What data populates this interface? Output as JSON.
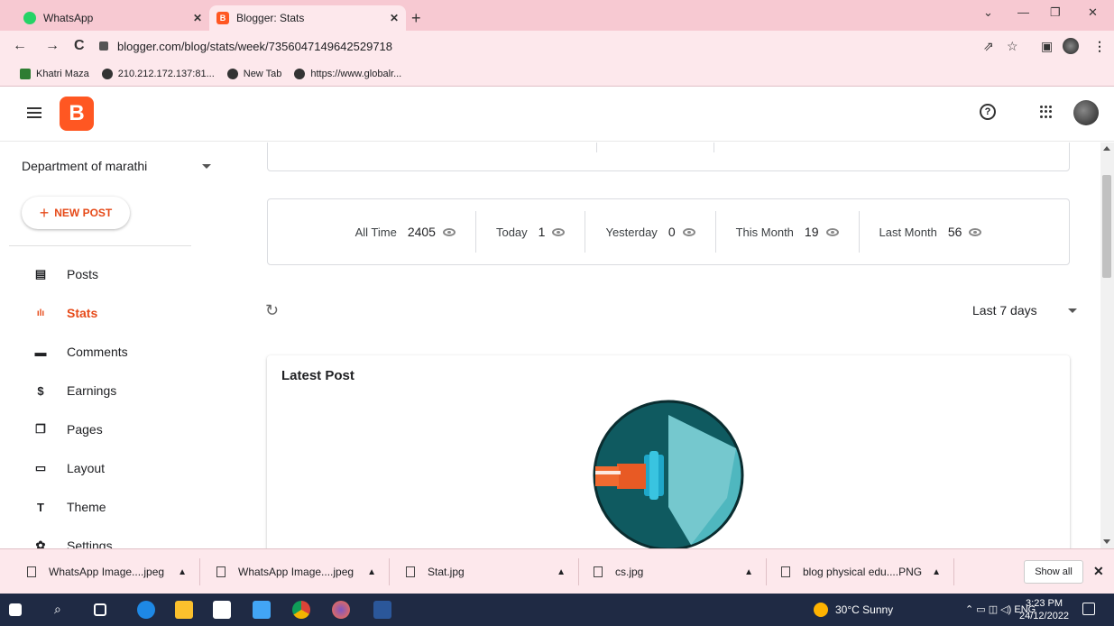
{
  "browser": {
    "tabs": [
      {
        "label": "WhatsApp",
        "icon": "whatsapp-icon",
        "color": "#25d366"
      },
      {
        "label": "Blogger: Stats",
        "icon": "blogger-icon",
        "color": "#ff5722"
      }
    ],
    "url": "blogger.com/blog/stats/week/7356047149642529718",
    "bookmarks": [
      {
        "label": "Khatri Maza"
      },
      {
        "label": "210.212.172.137:81..."
      },
      {
        "label": "New Tab"
      },
      {
        "label": "https://www.globalr..."
      }
    ]
  },
  "blogger": {
    "logo_letter": "B",
    "accent": "#ff5722",
    "help_label": "?"
  },
  "sidebar": {
    "blog_name": "Department of marathi",
    "new_post": "NEW POST",
    "items": [
      {
        "label": "Posts",
        "icon": "posts-icon",
        "glyph": "▤"
      },
      {
        "label": "Stats",
        "icon": "stats-icon",
        "glyph": "ılı",
        "active": true
      },
      {
        "label": "Comments",
        "icon": "comments-icon",
        "glyph": "▬"
      },
      {
        "label": "Earnings",
        "icon": "earnings-icon",
        "glyph": "$"
      },
      {
        "label": "Pages",
        "icon": "pages-icon",
        "glyph": "❐"
      },
      {
        "label": "Layout",
        "icon": "layout-icon",
        "glyph": "▭"
      },
      {
        "label": "Theme",
        "icon": "theme-icon",
        "glyph": "T"
      },
      {
        "label": "Settings",
        "icon": "settings-icon",
        "glyph": "✿"
      }
    ]
  },
  "stats": {
    "items": [
      {
        "label": "All Time",
        "value": "2405"
      },
      {
        "label": "Today",
        "value": "1"
      },
      {
        "label": "Yesterday",
        "value": "0"
      },
      {
        "label": "This Month",
        "value": "19"
      },
      {
        "label": "Last Month",
        "value": "56"
      }
    ],
    "range": "Last 7 days",
    "latest_post_title": "Latest Post"
  },
  "downloads": {
    "items": [
      {
        "name": "WhatsApp Image....jpeg"
      },
      {
        "name": "WhatsApp Image....jpeg"
      },
      {
        "name": "Stat.jpg"
      },
      {
        "name": "cs.jpg"
      },
      {
        "name": "blog physical edu....PNG"
      }
    ],
    "show_all": "Show all"
  },
  "taskbar": {
    "weather": "30°C  Sunny",
    "lang": "ENG",
    "time": "3:23 PM",
    "date": "24/12/2022"
  }
}
